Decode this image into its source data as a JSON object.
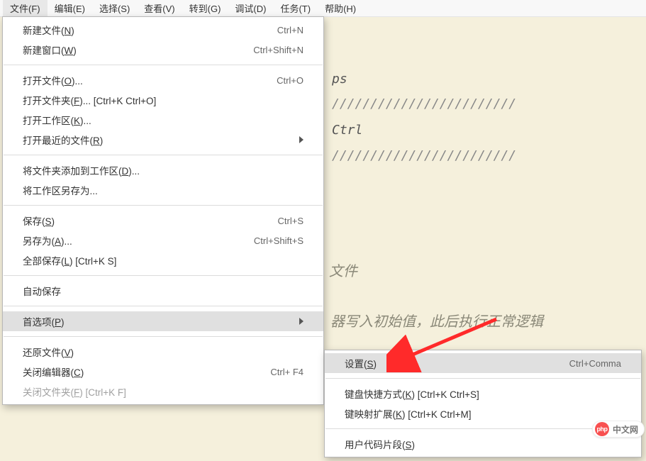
{
  "menubar": {
    "items": [
      {
        "label": "文件(F)"
      },
      {
        "label": "编辑(E)"
      },
      {
        "label": "选择(S)"
      },
      {
        "label": "查看(V)"
      },
      {
        "label": "转到(G)"
      },
      {
        "label": "调试(D)"
      },
      {
        "label": "任务(T)"
      },
      {
        "label": "帮助(H)"
      }
    ]
  },
  "editor": {
    "line1": "ps",
    "line2": "////////////////////////",
    "line3": "Ctrl",
    "line4": "////////////////////////",
    "line5": "文件",
    "line6": "器写入初始值，此后执行正常逻辑"
  },
  "fileMenu": {
    "newFile": {
      "pre": "新建文件(",
      "u": "N",
      "post": ")",
      "shortcut": "Ctrl+N"
    },
    "newWindow": {
      "pre": "新建窗口(",
      "u": "W",
      "post": ")",
      "shortcut": "Ctrl+Shift+N"
    },
    "openFile": {
      "pre": "打开文件(",
      "u": "O",
      "post": ")...",
      "shortcut": "Ctrl+O"
    },
    "openFolder": {
      "pre": "打开文件夹(",
      "u": "F",
      "post": ")... [Ctrl+K Ctrl+O]",
      "shortcut": ""
    },
    "openWorkspace": {
      "pre": "打开工作区(",
      "u": "K",
      "post": ")...",
      "shortcut": ""
    },
    "openRecent": {
      "pre": "打开最近的文件(",
      "u": "R",
      "post": ")",
      "shortcut": ""
    },
    "addFolderToWs": {
      "pre": "将文件夹添加到工作区(",
      "u": "D",
      "post": ")...",
      "shortcut": ""
    },
    "saveWsAs": {
      "pre": "将工作区另存为...",
      "u": "",
      "post": "",
      "shortcut": ""
    },
    "save": {
      "pre": "保存(",
      "u": "S",
      "post": ")",
      "shortcut": "Ctrl+S"
    },
    "saveAs": {
      "pre": "另存为(",
      "u": "A",
      "post": ")...",
      "shortcut": "Ctrl+Shift+S"
    },
    "saveAll": {
      "pre": "全部保存(",
      "u": "L",
      "post": ") [Ctrl+K S]",
      "shortcut": ""
    },
    "autoSave": {
      "pre": "自动保存",
      "u": "",
      "post": "",
      "shortcut": ""
    },
    "preferences": {
      "pre": "首选项(",
      "u": "P",
      "post": ")",
      "shortcut": ""
    },
    "revert": {
      "pre": "还原文件(",
      "u": "V",
      "post": ")",
      "shortcut": ""
    },
    "closeEditor": {
      "pre": "关闭编辑器(",
      "u": "C",
      "post": ")",
      "shortcut": "Ctrl+  F4"
    },
    "closeFolder": {
      "pre": "关闭文件夹(",
      "u": "F",
      "post": ") [Ctrl+K F]",
      "shortcut": ""
    }
  },
  "subMenu": {
    "settings": {
      "pre": "设置(",
      "u": "S",
      "post": ")",
      "shortcut": "Ctrl+Comma"
    },
    "keyboardShortcuts": {
      "pre": "键盘快捷方式(",
      "u": "K",
      "post": ") [Ctrl+K Ctrl+S]",
      "shortcut": ""
    },
    "keymapExtensions": {
      "pre": "键映射扩展(",
      "u": "K",
      "post": ") [Ctrl+K Ctrl+M]",
      "shortcut": ""
    },
    "userSnippets": {
      "pre": "用户代码片段(",
      "u": "S",
      "post": ")",
      "shortcut": ""
    }
  },
  "badge": {
    "logo": "php",
    "text": "中文网"
  }
}
